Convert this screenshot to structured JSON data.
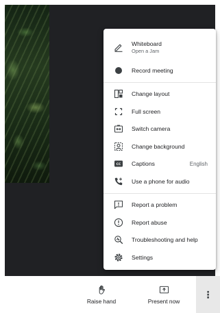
{
  "menu": {
    "items": [
      {
        "id": "whiteboard",
        "label": "Whiteboard",
        "sublabel": "Open a Jam",
        "icon": "pencil-icon"
      },
      {
        "id": "record",
        "label": "Record meeting",
        "icon": "record-dot-icon"
      },
      {
        "id": "layout",
        "label": "Change layout",
        "icon": "layout-icon"
      },
      {
        "id": "fullscreen",
        "label": "Full screen",
        "icon": "fullscreen-icon"
      },
      {
        "id": "switch-camera",
        "label": "Switch camera",
        "icon": "switch-camera-icon"
      },
      {
        "id": "background",
        "label": "Change background",
        "icon": "background-icon"
      },
      {
        "id": "captions",
        "label": "Captions",
        "value": "English",
        "icon": "captions-icon"
      },
      {
        "id": "phone-audio",
        "label": "Use a phone for audio",
        "icon": "phone-icon"
      },
      {
        "id": "report-problem",
        "label": "Report a problem",
        "icon": "report-problem-icon"
      },
      {
        "id": "report-abuse",
        "label": "Report abuse",
        "icon": "report-abuse-icon"
      },
      {
        "id": "troubleshooting",
        "label": "Troubleshooting and help",
        "icon": "troubleshooting-icon"
      },
      {
        "id": "settings",
        "label": "Settings",
        "icon": "settings-icon"
      }
    ]
  },
  "toolbar": {
    "raise_hand": {
      "label": "Raise hand",
      "icon": "hand-icon"
    },
    "present_now": {
      "label": "Present now",
      "icon": "present-icon"
    },
    "more_options": {
      "icon": "more-vert-icon",
      "glyph": "⋮"
    }
  },
  "colors": {
    "stage_bg": "#202124",
    "menu_bg": "#ffffff",
    "text": "#202124",
    "secondary_text": "#5f6368",
    "icon": "#3c4043",
    "more_button_bg": "#e8e8e8"
  }
}
